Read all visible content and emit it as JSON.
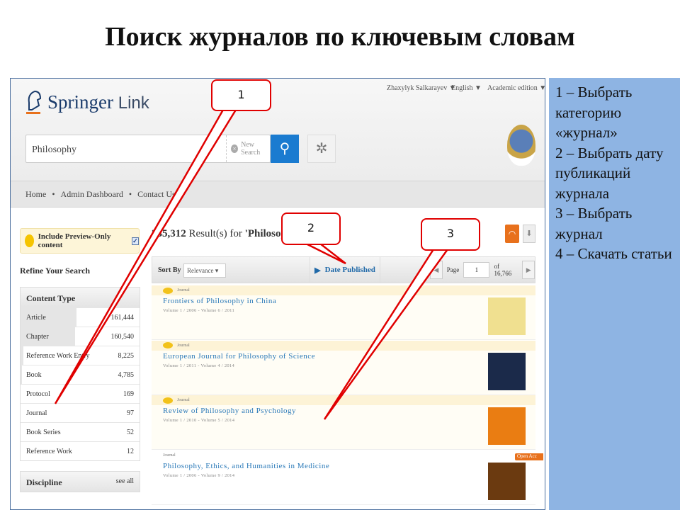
{
  "slide": {
    "title": "Поиск журналов по ключевым словам",
    "steps": [
      "1 – Выбрать категорию «журнал»",
      "2 – Выбрать дату публикаций журнала",
      "3 – Выбрать журнал",
      "4 – Скачать статьи"
    ],
    "callouts": [
      "1",
      "2",
      "3"
    ]
  },
  "header": {
    "brand": "Springer",
    "brand_suffix": "Link",
    "user": "Zhaxylyk Salkarayev ▼",
    "language": "English ▼",
    "edition": "Academic edition ▼"
  },
  "search": {
    "value": "Philosophy",
    "new_search": "New Search"
  },
  "nav": [
    "Home",
    "Admin Dashboard",
    "Contact Us"
  ],
  "preview": {
    "label": "Include Preview-Only content",
    "checked": true
  },
  "refine": "Refine Your Search",
  "content_type": {
    "title": "Content Type",
    "items": [
      {
        "label": "Article",
        "count": "161,444",
        "share": 0.66
      },
      {
        "label": "Chapter",
        "count": "160,540",
        "share": 0.64
      },
      {
        "label": "Reference Work Entry",
        "count": "8,225",
        "share": 0.03
      },
      {
        "label": "Book",
        "count": "4,785",
        "share": 0.02
      },
      {
        "label": "Protocol",
        "count": "169",
        "share": 0
      },
      {
        "label": "Journal",
        "count": "97",
        "share": 0
      },
      {
        "label": "Book Series",
        "count": "52",
        "share": 0
      },
      {
        "label": "Reference Work",
        "count": "12",
        "share": 0
      }
    ]
  },
  "discipline": {
    "title": "Discipline",
    "see_all": "see all"
  },
  "results": {
    "count": "335,312",
    "text": " Result(s) for ",
    "query": "'Philosophy'",
    "sort_label": "Sort By",
    "sort_value": "Relevance",
    "date_published": "Date Published",
    "page_label": "Page",
    "page": "1",
    "page_total": "of 16,766",
    "items": [
      {
        "type": "Journal",
        "title": "Frontiers of Philosophy in China",
        "volumes": "Volume 1 / 2006 - Volume 6 / 2011",
        "cover": "#f0e090"
      },
      {
        "type": "Journal",
        "title": "European Journal for Philosophy of Science",
        "volumes": "Volume 1 / 2011 - Volume 4 / 2014",
        "cover": "#1b2a4a"
      },
      {
        "type": "Journal",
        "title": "Review of Philosophy and Psychology",
        "volumes": "Volume 1 / 2010 - Volume 5 / 2014",
        "cover": "#ea7d12"
      },
      {
        "type": "Journal",
        "title": "Philosophy, Ethics, and Humanities in Medicine",
        "volumes": "Volume 1 / 2006 - Volume 9 / 2014",
        "cover": "#6b3a10"
      }
    ],
    "open_access": "Open Acc"
  }
}
